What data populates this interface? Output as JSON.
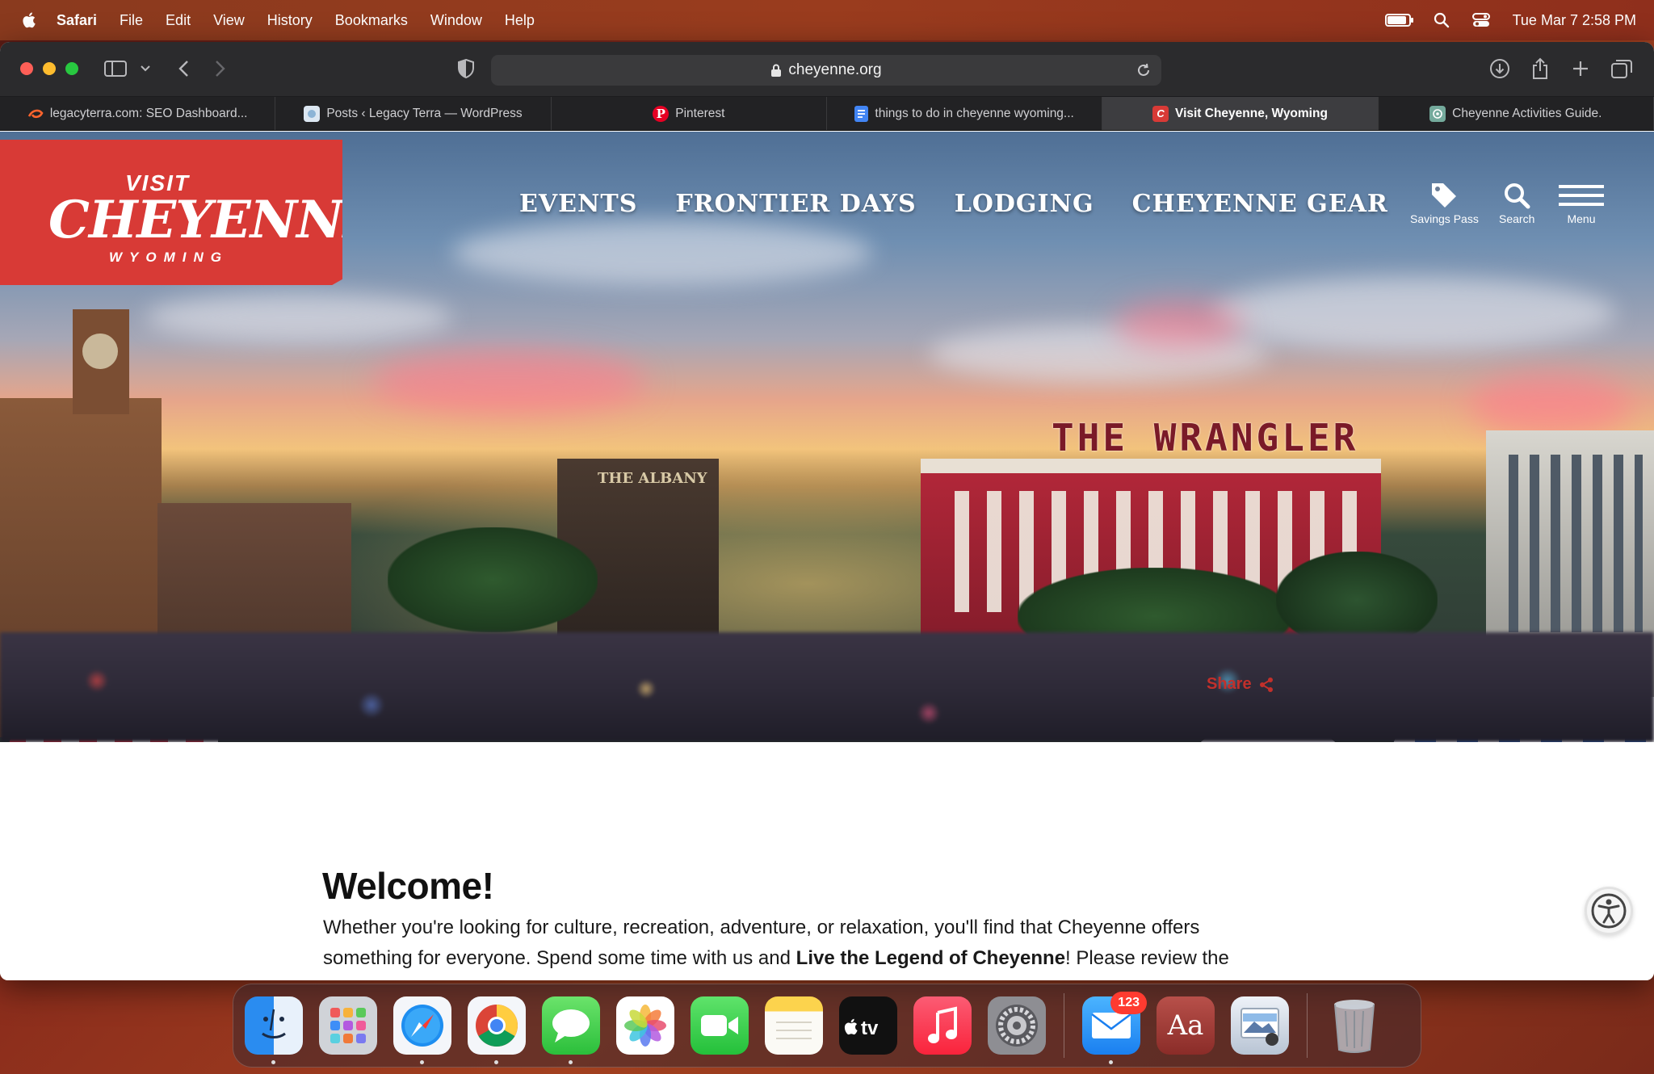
{
  "menubar": {
    "app_name": "Safari",
    "items": [
      "File",
      "Edit",
      "View",
      "History",
      "Bookmarks",
      "Window",
      "Help"
    ],
    "datetime": "Tue Mar 7  2:58 PM",
    "battery_level": 0.9
  },
  "browser": {
    "url": "cheyenne.org",
    "tabs": [
      {
        "title": "legacyterra.com: SEO Dashboard...",
        "icon": "semrush-icon",
        "active": false
      },
      {
        "title": "Posts ‹ Legacy Terra — WordPress",
        "icon": "wordpress-site-icon",
        "active": false
      },
      {
        "title": "Pinterest",
        "icon": "pinterest-icon",
        "active": false
      },
      {
        "title": "things to do in cheyenne wyoming...",
        "icon": "google-docs-icon",
        "active": false
      },
      {
        "title": "Visit Cheyenne, Wyoming",
        "icon": "visit-cheyenne-icon",
        "active": true
      },
      {
        "title": "Cheyenne Activities Guide.",
        "icon": "chatgpt-icon",
        "active": false
      }
    ]
  },
  "site": {
    "logo": {
      "visit": "VISIT",
      "name": "CHEYENNE",
      "state": "WYOMING"
    },
    "nav": [
      "EVENTS",
      "FRONTIER DAYS",
      "LODGING",
      "CHEYENNE GEAR"
    ],
    "tools": {
      "savings": "Savings Pass",
      "search": "Search",
      "menu": "Menu"
    },
    "hero_signs": {
      "wrangler": "THE WRANGLER",
      "albany": "THE ALBANY"
    },
    "share": "Share",
    "welcome": "Welcome!",
    "intro_line1": "Whether you're looking for culture, recreation, adventure, or relaxation, you'll find that Cheyenne offers",
    "intro_line2_pre": "something for everyone. Spend some time with us and ",
    "intro_line2_bold": "Live the Legend of Cheyenne",
    "intro_line2_post": "! Please review the"
  },
  "dock": {
    "apps": [
      "Finder",
      "Launchpad",
      "Safari",
      "Chrome",
      "Messages",
      "Photos",
      "FaceTime",
      "Notes",
      "TV",
      "Music",
      "System Settings"
    ],
    "apps2": [
      "Mail",
      "Dictionary",
      "Preview"
    ],
    "mail_badge": "123",
    "trash": "Trash"
  },
  "colors": {
    "brand_red": "#d83a36",
    "share_red": "#c2302b"
  }
}
